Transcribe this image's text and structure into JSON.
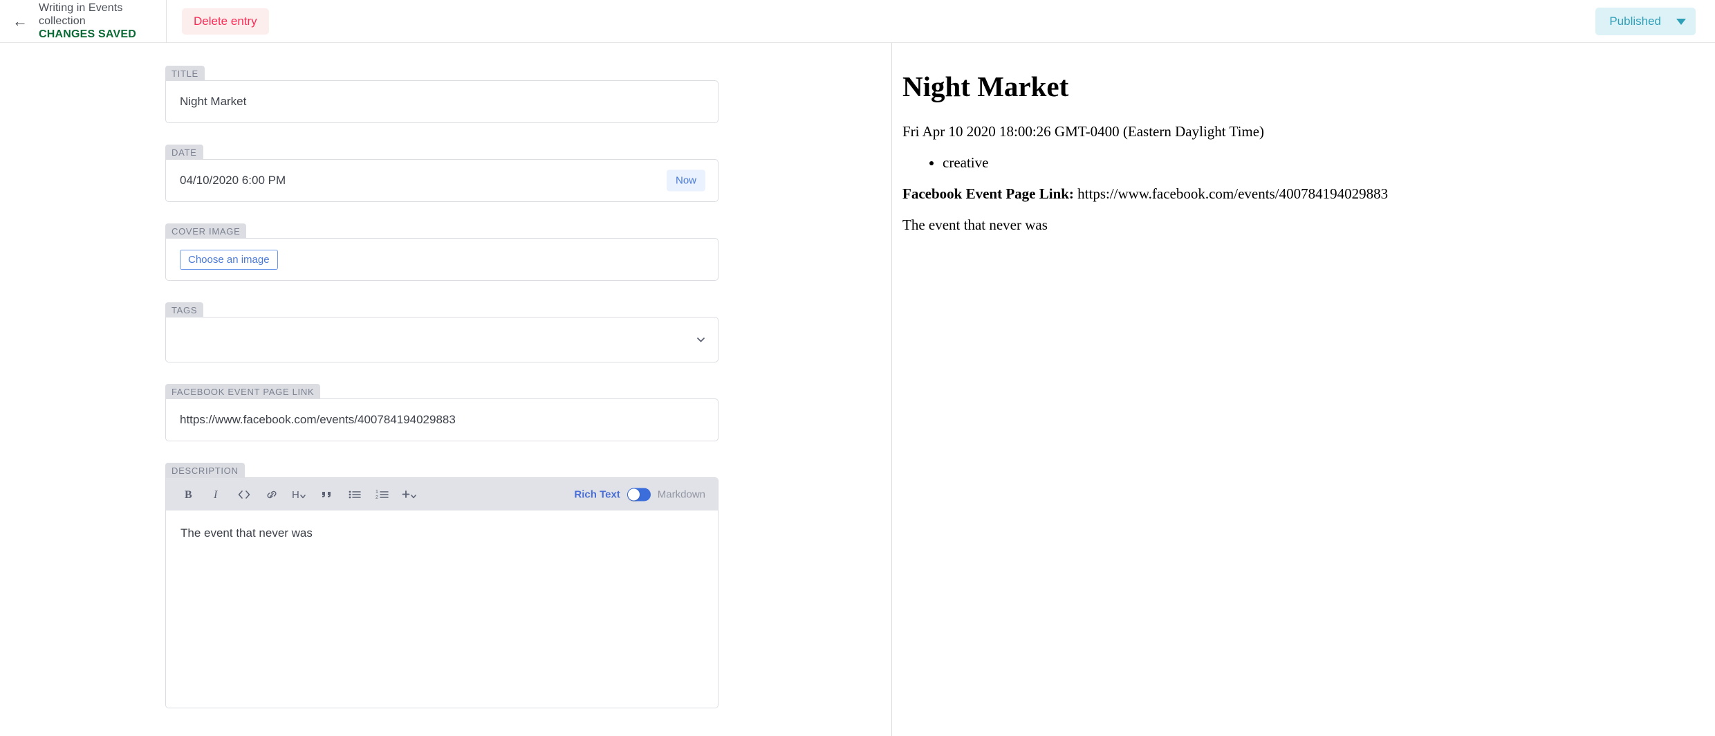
{
  "topbar": {
    "back_icon": "arrow-left-icon",
    "collection_label": "Writing in Events collection",
    "status_label": "CHANGES SAVED",
    "delete_label": "Delete entry",
    "publish_label": "Published",
    "publish_caret_icon": "chevron-down-icon",
    "status_color": "#0b6a35",
    "delete_color": "#fb2c55",
    "delete_bg": "#fdeeee",
    "publish_color": "#2f9fb8",
    "publish_bg": "#ddf2f6"
  },
  "fields": {
    "title": {
      "label": "TITLE",
      "value": "Night Market"
    },
    "date": {
      "label": "DATE",
      "value": "04/10/2020 6:00 PM",
      "now_label": "Now"
    },
    "cover_image": {
      "label": "COVER IMAGE",
      "button_label": "Choose an image"
    },
    "tags": {
      "label": "TAGS",
      "value": "",
      "caret_icon": "chevron-down-icon"
    },
    "facebook_link": {
      "label": "FACEBOOK EVENT PAGE LINK",
      "value": "https://www.facebook.com/events/400784194029883"
    },
    "description": {
      "label": "DESCRIPTION",
      "value": "The event that never was"
    }
  },
  "editor": {
    "tools": [
      {
        "name": "bold-icon",
        "label": "B"
      },
      {
        "name": "italic-icon",
        "label": "I"
      },
      {
        "name": "code-icon",
        "label": "<>"
      },
      {
        "name": "link-icon",
        "label": "link"
      },
      {
        "name": "heading-icon",
        "label": "H"
      },
      {
        "name": "quote-icon",
        "label": "”"
      },
      {
        "name": "bullet-list-icon",
        "label": "list"
      },
      {
        "name": "numbered-list-icon",
        "label": "1. list"
      },
      {
        "name": "add-component-icon",
        "label": "+"
      }
    ],
    "mode_left_label": "Rich Text",
    "mode_right_label": "Markdown",
    "mode_active": "Rich Text",
    "toggle_color": "#3c6edb"
  },
  "preview": {
    "title": "Night Market",
    "date_line": "Fri Apr 10 2020 18:00:26 GMT-0400 (Eastern Daylight Time)",
    "tags": [
      "creative"
    ],
    "link_label": "Facebook Event Page Link:",
    "link_value": "https://www.facebook.com/events/400784194029883",
    "body": "The event that never was"
  }
}
